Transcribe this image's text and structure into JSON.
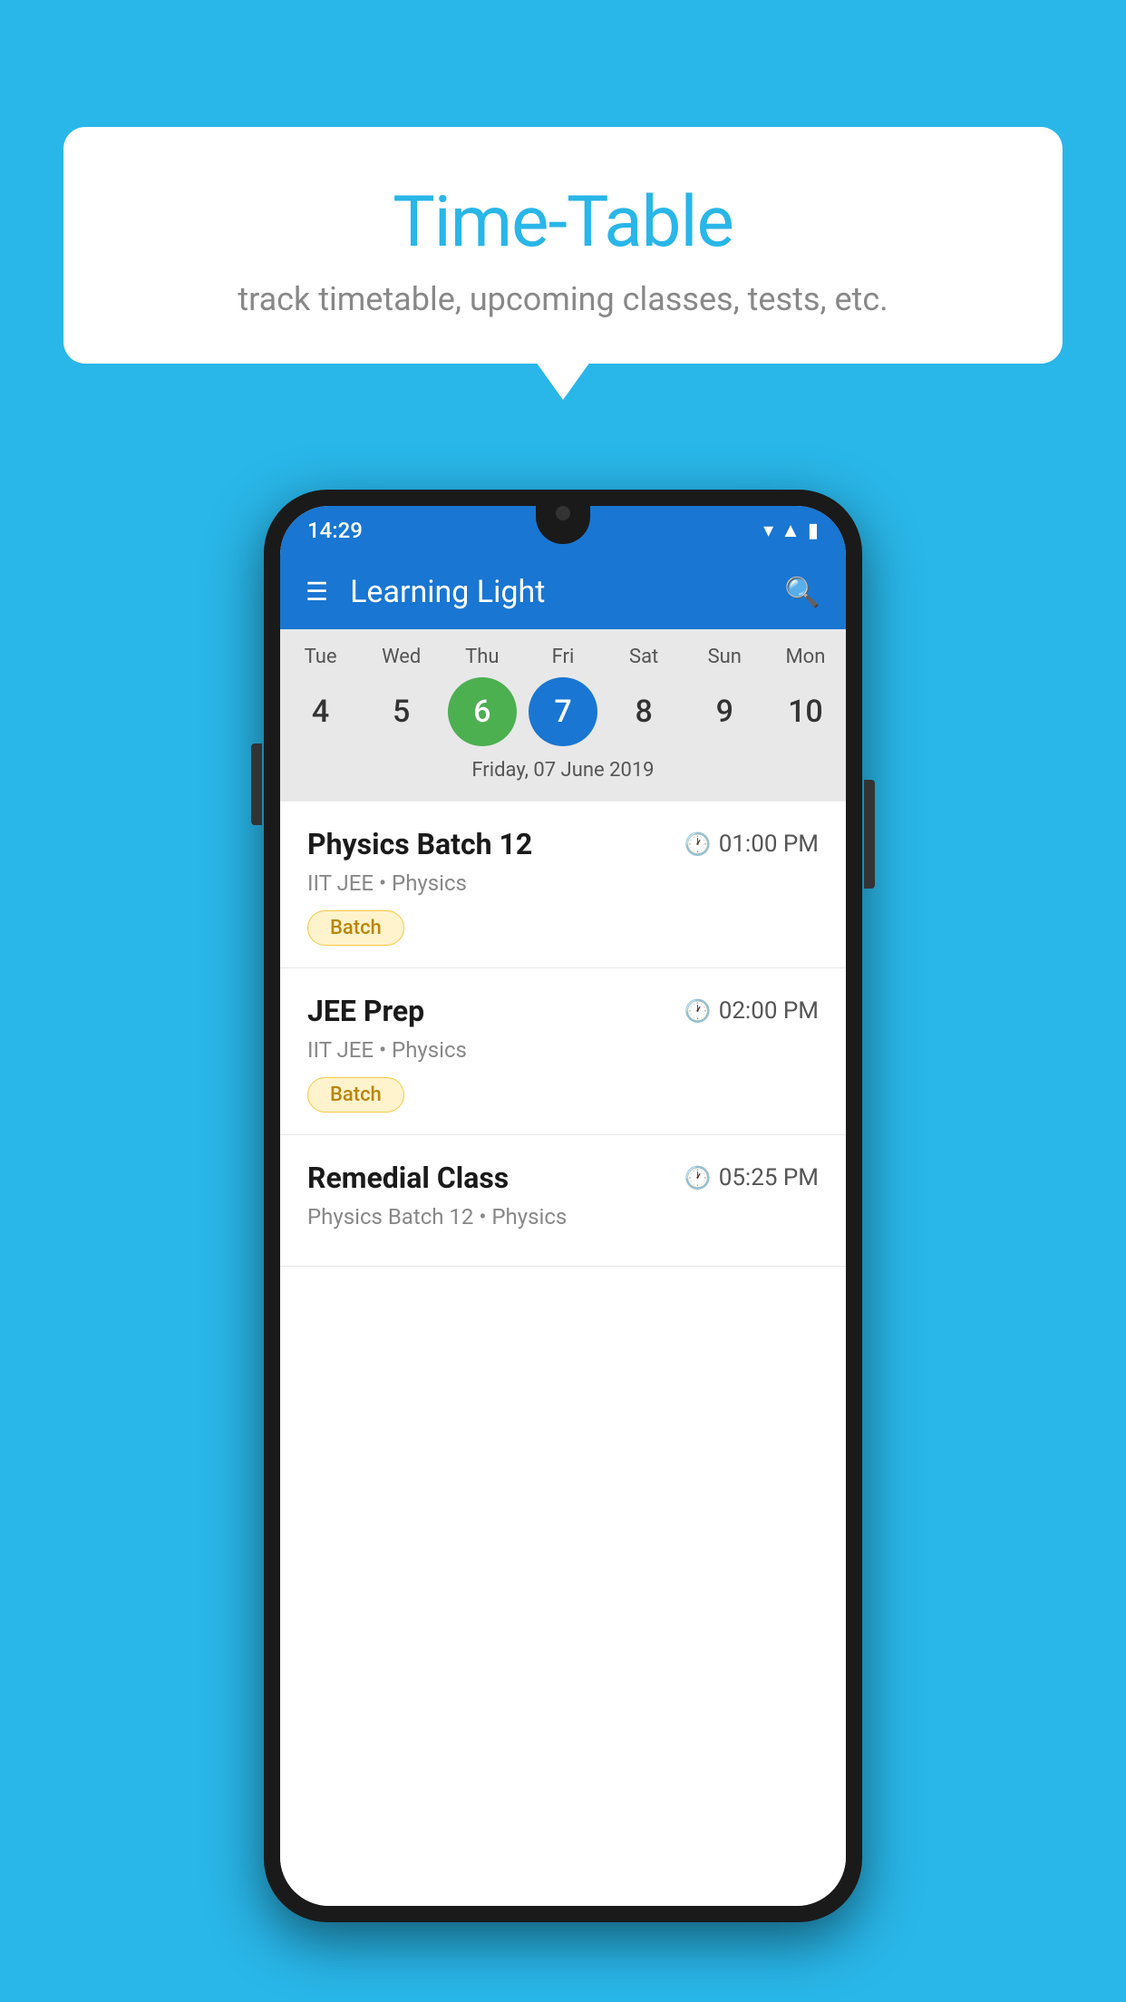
{
  "background": {
    "color": "#29B6E8"
  },
  "speech_bubble": {
    "title": "Time-Table",
    "subtitle": "track timetable, upcoming classes, tests, etc."
  },
  "phone": {
    "status_bar": {
      "time": "14:29"
    },
    "app_header": {
      "title": "Learning Light"
    },
    "calendar": {
      "days": [
        {
          "label": "Tue",
          "number": "4"
        },
        {
          "label": "Wed",
          "number": "5"
        },
        {
          "label": "Thu",
          "number": "6",
          "state": "today"
        },
        {
          "label": "Fri",
          "number": "7",
          "state": "selected"
        },
        {
          "label": "Sat",
          "number": "8"
        },
        {
          "label": "Sun",
          "number": "9"
        },
        {
          "label": "Mon",
          "number": "10"
        }
      ],
      "selected_date": "Friday, 07 June 2019"
    },
    "classes": [
      {
        "name": "Physics Batch 12",
        "time": "01:00 PM",
        "subject": "IIT JEE • Physics",
        "badge": "Batch"
      },
      {
        "name": "JEE Prep",
        "time": "02:00 PM",
        "subject": "IIT JEE • Physics",
        "badge": "Batch"
      },
      {
        "name": "Remedial Class",
        "time": "05:25 PM",
        "subject": "Physics Batch 12 • Physics",
        "badge": ""
      }
    ]
  }
}
